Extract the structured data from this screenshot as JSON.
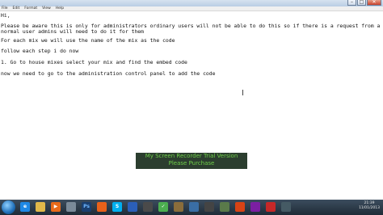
{
  "menu": [
    "File",
    "Edit",
    "Format",
    "View",
    "Help"
  ],
  "window_controls": {
    "minimize": "–",
    "maximize": "□",
    "close": "✕"
  },
  "lines": [
    "Hi,",
    "",
    "Please be aware this is only for administrators ordinary users will not be able to do this so if there is a request from a",
    "normal user admins will need to do it for them",
    "",
    "For each mix we will use the name of the mix as the code",
    "",
    "follow each step i do now",
    "",
    "1. Go to house mixes select your mix and find the embed code",
    "",
    "now we need to go to the administration control panel to add the code"
  ],
  "watermark": [
    "My Screen Recorder Trial Version",
    "Please Purchase"
  ],
  "taskbar": {
    "icons": [
      "ie-icon",
      "explorer-icon",
      "media-player-icon",
      "unknown-app-icon",
      "firefox-icon",
      "photoshop-icon",
      "skype-icon",
      "bluetooth-icon",
      "chrome-icon",
      "app-icon",
      "torrent-icon",
      "app-icon-2",
      "app-icon-3",
      "chrome-icon-2",
      "media-icon",
      "app-icon-4",
      "app-icon-5",
      "app-icon-6",
      "app-icon-7"
    ],
    "clock_time": "21:39",
    "clock_date": "11/01/2013"
  }
}
